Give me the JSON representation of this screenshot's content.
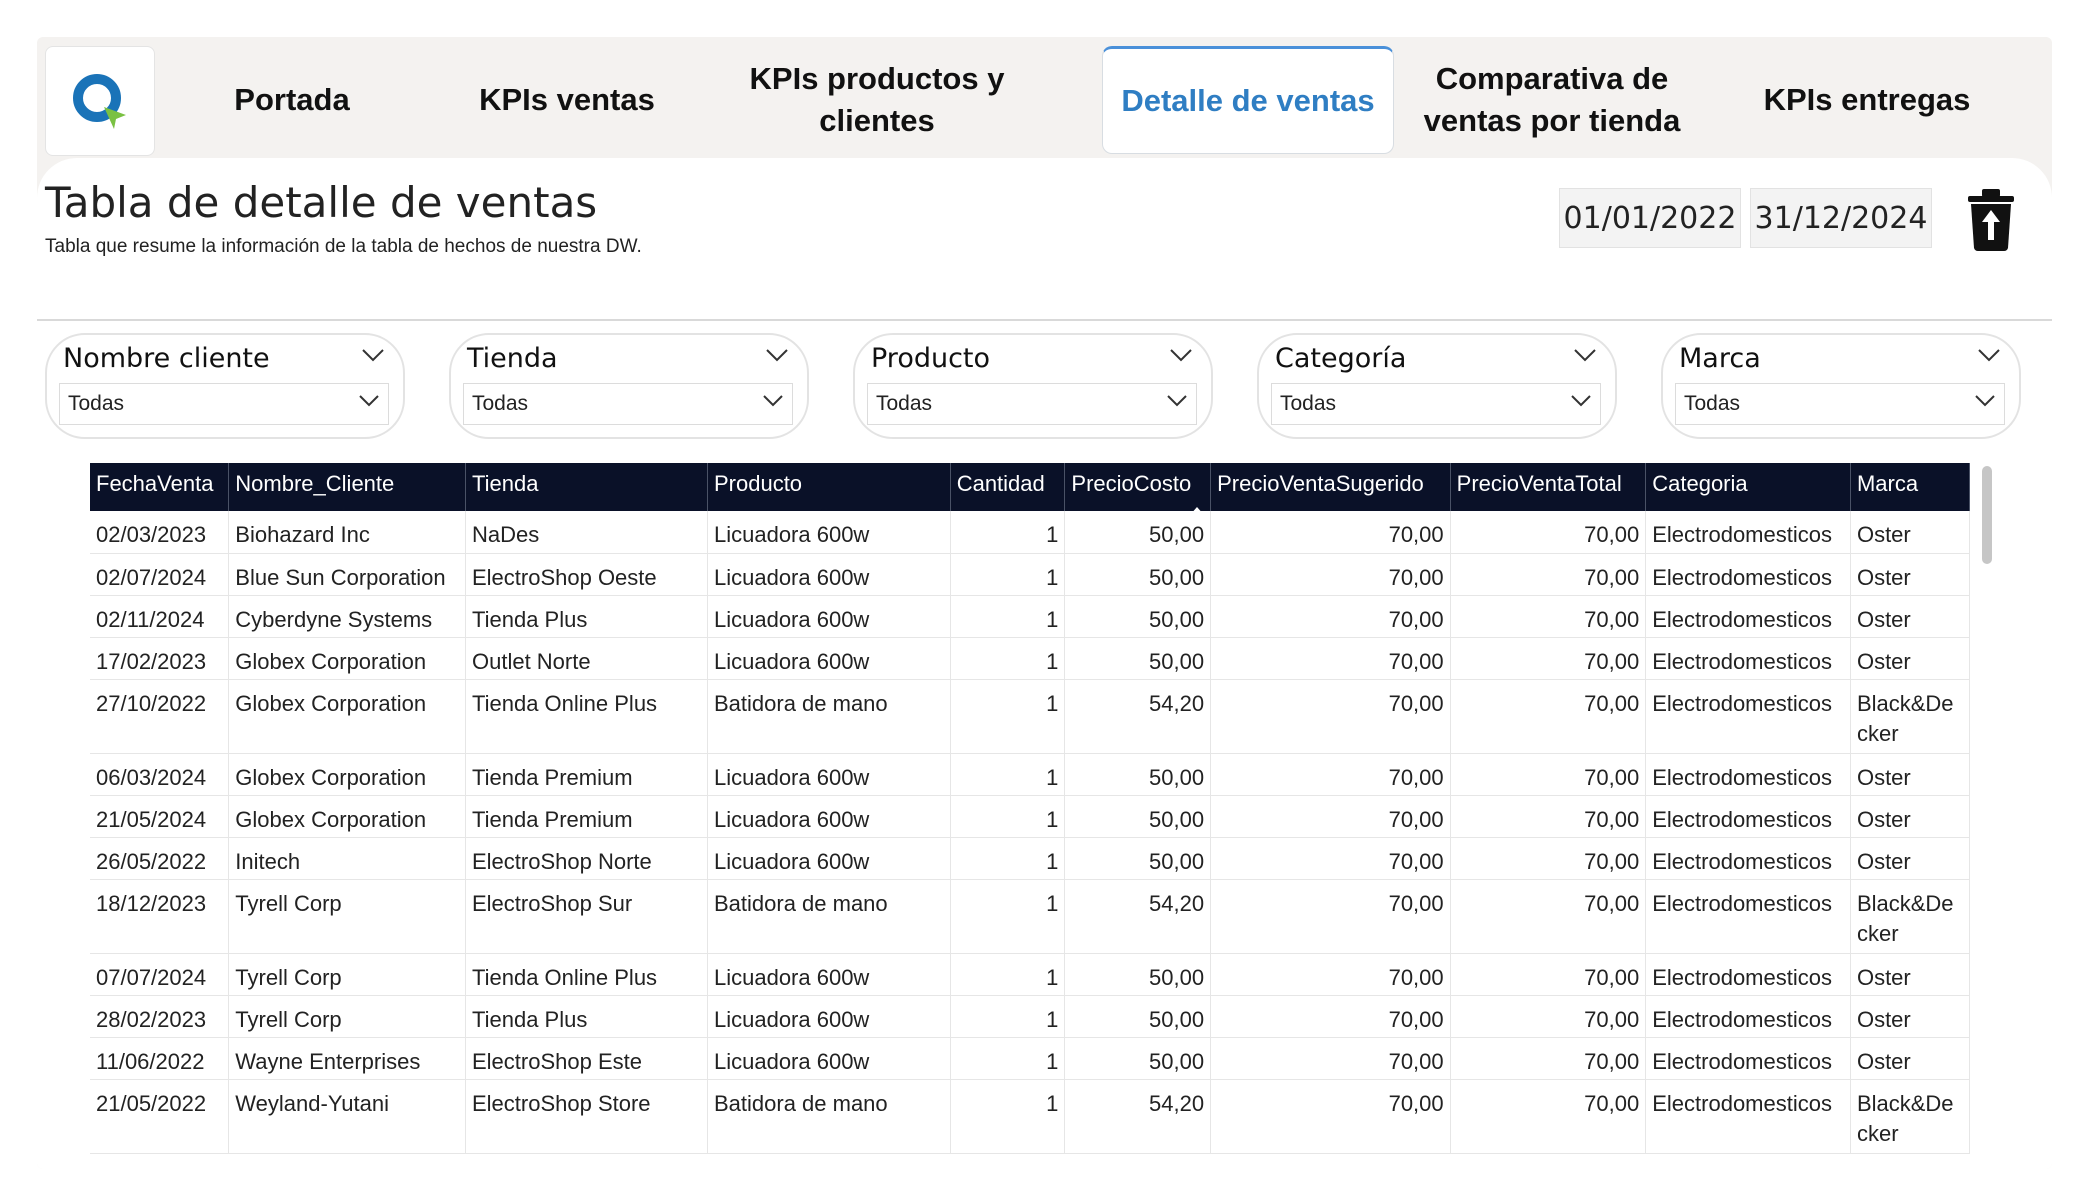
{
  "nav": {
    "tabs": [
      {
        "label": "Portada"
      },
      {
        "label": "KPIs ventas"
      },
      {
        "label": "KPIs productos y clientes"
      },
      {
        "label": "Detalle de ventas"
      },
      {
        "label": "Comparativa de ventas por tienda"
      },
      {
        "label": "KPIs entregas"
      }
    ],
    "active_tab": "Detalle de ventas",
    "logo_icon": "q-logo-icon",
    "colors": {
      "active": "#2f7ec3",
      "logo_blue": "#1a73b8",
      "logo_green": "#7ac143"
    }
  },
  "page": {
    "title": "Tabla de detalle de ventas",
    "subtitle": "Tabla que resume la información de la tabla de hechos de nuestra DW."
  },
  "date_range": {
    "start": "01/01/2022",
    "end": "31/12/2024"
  },
  "clear_filters_icon": "trash-upload-icon",
  "slicers": [
    {
      "label": "Nombre cliente",
      "value": "Todas"
    },
    {
      "label": "Tienda",
      "value": "Todas"
    },
    {
      "label": "Producto",
      "value": "Todas"
    },
    {
      "label": "Categoría",
      "value": "Todas"
    },
    {
      "label": "Marca",
      "value": "Todas"
    }
  ],
  "table": {
    "header_color": "#0a1128",
    "sorted_column": "PrecioVentaTotal",
    "sort_direction": "ascending",
    "columns": [
      "FechaVenta",
      "Nombre_Cliente",
      "Tienda",
      "Producto",
      "Cantidad",
      "PrecioCosto",
      "PrecioVentaSugerido",
      "PrecioVentaTotal",
      "Categoria",
      "Marca"
    ],
    "rows": [
      [
        "02/03/2023",
        "Biohazard Inc",
        "NaDes",
        "Licuadora 600w",
        "1",
        "50,00",
        "70,00",
        "70,00",
        "Electrodomesticos",
        "Oster"
      ],
      [
        "02/07/2024",
        "Blue Sun Corporation",
        "ElectroShop Oeste",
        "Licuadora 600w",
        "1",
        "50,00",
        "70,00",
        "70,00",
        "Electrodomesticos",
        "Oster"
      ],
      [
        "02/11/2024",
        "Cyberdyne Systems",
        "Tienda Plus",
        "Licuadora 600w",
        "1",
        "50,00",
        "70,00",
        "70,00",
        "Electrodomesticos",
        "Oster"
      ],
      [
        "17/02/2023",
        "Globex Corporation",
        "Outlet Norte",
        "Licuadora 600w",
        "1",
        "50,00",
        "70,00",
        "70,00",
        "Electrodomesticos",
        "Oster"
      ],
      [
        "27/10/2022",
        "Globex Corporation",
        "Tienda Online Plus",
        "Batidora de mano",
        "1",
        "54,20",
        "70,00",
        "70,00",
        "Electrodomesticos",
        "Black&Decker"
      ],
      [
        "06/03/2024",
        "Globex Corporation",
        "Tienda Premium",
        "Licuadora 600w",
        "1",
        "50,00",
        "70,00",
        "70,00",
        "Electrodomesticos",
        "Oster"
      ],
      [
        "21/05/2024",
        "Globex Corporation",
        "Tienda Premium",
        "Licuadora 600w",
        "1",
        "50,00",
        "70,00",
        "70,00",
        "Electrodomesticos",
        "Oster"
      ],
      [
        "26/05/2022",
        "Initech",
        "ElectroShop Norte",
        "Licuadora 600w",
        "1",
        "50,00",
        "70,00",
        "70,00",
        "Electrodomesticos",
        "Oster"
      ],
      [
        "18/12/2023",
        "Tyrell Corp",
        "ElectroShop Sur",
        "Batidora de mano",
        "1",
        "54,20",
        "70,00",
        "70,00",
        "Electrodomesticos",
        "Black&Decker"
      ],
      [
        "07/07/2024",
        "Tyrell Corp",
        "Tienda Online Plus",
        "Licuadora 600w",
        "1",
        "50,00",
        "70,00",
        "70,00",
        "Electrodomesticos",
        "Oster"
      ],
      [
        "28/02/2023",
        "Tyrell Corp",
        "Tienda Plus",
        "Licuadora 600w",
        "1",
        "50,00",
        "70,00",
        "70,00",
        "Electrodomesticos",
        "Oster"
      ],
      [
        "11/06/2022",
        "Wayne Enterprises",
        "ElectroShop Este",
        "Licuadora 600w",
        "1",
        "50,00",
        "70,00",
        "70,00",
        "Electrodomesticos",
        "Oster"
      ],
      [
        "21/05/2022",
        "Weyland-Yutani",
        "ElectroShop Store",
        "Batidora de mano",
        "1",
        "54,20",
        "70,00",
        "70,00",
        "Electrodomesticos",
        "Black&Decker"
      ]
    ]
  }
}
